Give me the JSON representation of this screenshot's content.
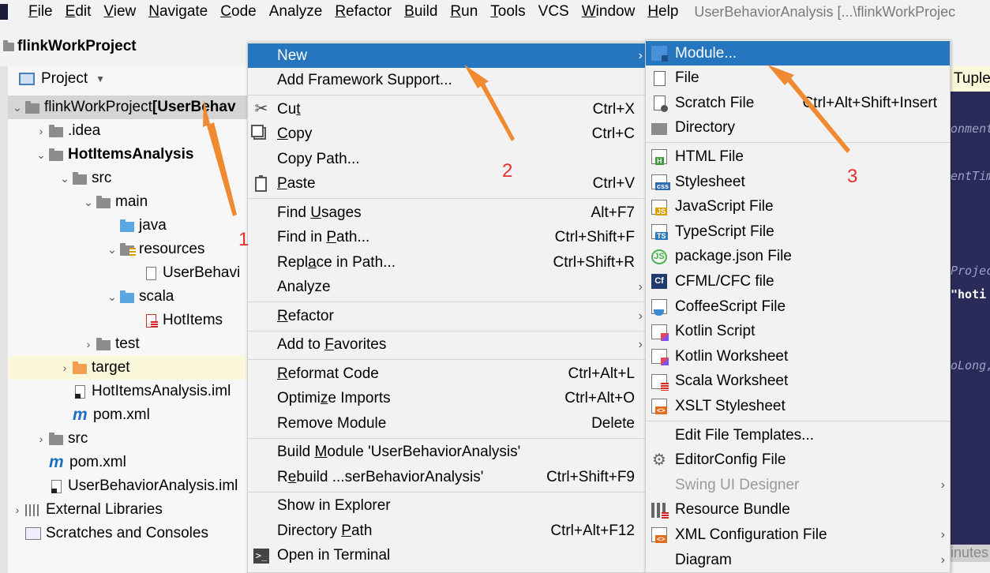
{
  "menubar": {
    "items": [
      {
        "label": "File",
        "mn": "F",
        "rest": "ile"
      },
      {
        "label": "Edit",
        "mn": "E",
        "rest": "dit"
      },
      {
        "label": "View",
        "mn": "V",
        "rest": "iew"
      },
      {
        "label": "Navigate",
        "mn": "N",
        "rest": "avigate"
      },
      {
        "label": "Code",
        "mn": "C",
        "rest": "ode"
      },
      {
        "label": "Analyze",
        "mn": "",
        "rest": "Analyze"
      },
      {
        "label": "Refactor",
        "mn": "R",
        "rest": "efactor"
      },
      {
        "label": "Build",
        "mn": "B",
        "rest": "uild"
      },
      {
        "label": "Run",
        "mn": "R",
        "rest": "un"
      },
      {
        "label": "Tools",
        "mn": "T",
        "rest": "ools"
      },
      {
        "label": "VCS",
        "mn": "",
        "rest": "VCS"
      },
      {
        "label": "Window",
        "mn": "W",
        "rest": "indow"
      },
      {
        "label": "Help",
        "mn": "H",
        "rest": "elp"
      }
    ],
    "window_title": "UserBehaviorAnalysis [...\\flinkWorkProjec"
  },
  "project_bar": {
    "name": "flinkWorkProject"
  },
  "panel": {
    "title": "Project",
    "dropdown": "▼"
  },
  "tree": [
    {
      "text": "flinkWorkProject ",
      "bold_suffix": "[UserBehav",
      "arrow": "⌄",
      "indent": 0,
      "icon": "folder",
      "state": "selected"
    },
    {
      "text": ".idea",
      "arrow": "›",
      "indent": 1,
      "icon": "folder"
    },
    {
      "text": "HotItemsAnalysis",
      "arrow": "⌄",
      "indent": 1,
      "icon": "folder",
      "bold": true
    },
    {
      "text": "src",
      "arrow": "⌄",
      "indent": 2,
      "icon": "folder"
    },
    {
      "text": "main",
      "arrow": "⌄",
      "indent": 3,
      "icon": "folder"
    },
    {
      "text": "java",
      "arrow": "",
      "indent": 4,
      "icon": "folder blue"
    },
    {
      "text": "resources",
      "arrow": "⌄",
      "indent": 4,
      "icon": "folder res"
    },
    {
      "text": "UserBehavi",
      "arrow": "",
      "indent": 5,
      "icon": "file"
    },
    {
      "text": "scala",
      "arrow": "⌄",
      "indent": 4,
      "icon": "folder blue"
    },
    {
      "text": "HotItems",
      "arrow": "",
      "indent": 5,
      "icon": "file scala"
    },
    {
      "text": "test",
      "arrow": "›",
      "indent": 3,
      "icon": "folder"
    },
    {
      "text": "target",
      "arrow": "›",
      "indent": 2,
      "icon": "folder orange",
      "state": "highlight"
    },
    {
      "text": "HotItemsAnalysis.iml",
      "arrow": "",
      "indent": 2,
      "icon": "file iml"
    },
    {
      "text": "pom.xml",
      "arrow": "",
      "indent": 2,
      "icon": "m"
    },
    {
      "text": "src",
      "arrow": "›",
      "indent": 1,
      "icon": "folder"
    },
    {
      "text": "pom.xml",
      "arrow": "",
      "indent": 1,
      "icon": "m"
    },
    {
      "text": "UserBehaviorAnalysis.iml",
      "arrow": "",
      "indent": 1,
      "icon": "file iml"
    },
    {
      "text": "External Libraries",
      "arrow": "›",
      "indent": 0,
      "icon": "lib"
    },
    {
      "text": "Scratches and Consoles",
      "arrow": "",
      "indent": 0,
      "icon": "scratch"
    }
  ],
  "context_menu": {
    "items": [
      {
        "label": "New",
        "shortcut": "",
        "submenu": true,
        "selected": true,
        "icon": ""
      },
      {
        "label": "Add Framework Support...",
        "shortcut": "",
        "icon": ""
      },
      {
        "sep": true
      },
      {
        "label": "Cut",
        "u": "t",
        "shortcut": "Ctrl+X",
        "icon": "cut"
      },
      {
        "label": "Copy",
        "u": "C",
        "shortcut": "Ctrl+C",
        "icon": "copy"
      },
      {
        "label": "Copy Path...",
        "shortcut": "",
        "icon": ""
      },
      {
        "label": "Paste",
        "u": "P",
        "shortcut": "Ctrl+V",
        "icon": "paste"
      },
      {
        "sep": true
      },
      {
        "label": "Find Usages",
        "u": "U",
        "shortcut": "Alt+F7",
        "icon": ""
      },
      {
        "label": "Find in Path...",
        "u": "P",
        "shortcut": "Ctrl+Shift+F",
        "icon": ""
      },
      {
        "label": "Replace in Path...",
        "u": "a",
        "shortcut": "Ctrl+Shift+R",
        "icon": ""
      },
      {
        "label": "Analyze",
        "shortcut": "",
        "submenu": true,
        "icon": ""
      },
      {
        "sep": true
      },
      {
        "label": "Refactor",
        "u": "R",
        "shortcut": "",
        "submenu": true,
        "icon": ""
      },
      {
        "sep": true
      },
      {
        "label": "Add to Favorites",
        "u": "F",
        "shortcut": "",
        "submenu": true,
        "icon": ""
      },
      {
        "sep": true
      },
      {
        "label": "Reformat Code",
        "u": "R",
        "shortcut": "Ctrl+Alt+L",
        "icon": ""
      },
      {
        "label": "Optimize Imports",
        "u": "z",
        "shortcut": "Ctrl+Alt+O",
        "icon": ""
      },
      {
        "label": "Remove Module",
        "shortcut": "Delete",
        "icon": ""
      },
      {
        "sep": true
      },
      {
        "label": "Build Module 'UserBehaviorAnalysis'",
        "u": "M",
        "shortcut": "",
        "icon": ""
      },
      {
        "label": "Rebuild ...serBehaviorAnalysis'",
        "u": "e",
        "shortcut": "Ctrl+Shift+F9",
        "icon": ""
      },
      {
        "sep": true
      },
      {
        "label": "Show in Explorer",
        "shortcut": "",
        "icon": ""
      },
      {
        "label": "Directory Path",
        "u": "P",
        "shortcut": "Ctrl+Alt+F12",
        "icon": ""
      },
      {
        "label": "Open in Terminal",
        "shortcut": "",
        "icon": "terminal"
      }
    ]
  },
  "sub_menu": {
    "items": [
      {
        "label": "Module...",
        "selected": true,
        "icon": "module"
      },
      {
        "label": "File",
        "icon": "file"
      },
      {
        "label": "Scratch File",
        "shortcut": "Ctrl+Alt+Shift+Insert",
        "icon": "scratch"
      },
      {
        "label": "Directory",
        "icon": "dir"
      },
      {
        "sep": true
      },
      {
        "label": "HTML File",
        "icon": "html",
        "badge": "H",
        "badge_color": "#3f9a3f"
      },
      {
        "label": "Stylesheet",
        "icon": "css",
        "badge": "css",
        "badge_color": "#2d6bb5"
      },
      {
        "label": "JavaScript File",
        "icon": "js",
        "badge": "JS",
        "badge_color": "#d8a000"
      },
      {
        "label": "TypeScript File",
        "icon": "ts",
        "badge": "TS",
        "badge_color": "#2e79b9"
      },
      {
        "label": "package.json File",
        "icon": "json"
      },
      {
        "label": "CFML/CFC file",
        "icon": "cf"
      },
      {
        "label": "CoffeeScript File",
        "icon": "coffee"
      },
      {
        "label": "Kotlin Script",
        "icon": "kotlin"
      },
      {
        "label": "Kotlin Worksheet",
        "icon": "kotlin"
      },
      {
        "label": "Scala Worksheet",
        "icon": "scala"
      },
      {
        "label": "XSLT Stylesheet",
        "icon": "xslt",
        "badge": "<>",
        "badge_color": "#e06c1c"
      },
      {
        "sep": true
      },
      {
        "label": "Edit File Templates...",
        "icon": ""
      },
      {
        "label": "EditorConfig File",
        "icon": "gear"
      },
      {
        "label": "Swing UI Designer",
        "icon": "",
        "disabled": true,
        "submenu": true
      },
      {
        "label": "Resource Bundle",
        "icon": "bundle"
      },
      {
        "label": "XML Configuration File",
        "icon": "xml",
        "badge": "<>",
        "badge_color": "#e06c1c",
        "submenu": true
      },
      {
        "label": "Diagram",
        "icon": "",
        "submenu": true
      }
    ]
  },
  "editor": {
    "tab": "Tuple",
    "fragments": [
      "onment",
      "entTim",
      "Projec",
      "\"hoti",
      "oLong,"
    ],
    "status": "inutes"
  },
  "annotations": {
    "labels": [
      "1",
      "2",
      "3"
    ],
    "color": "#f08a30",
    "label_color": "#e53030"
  }
}
